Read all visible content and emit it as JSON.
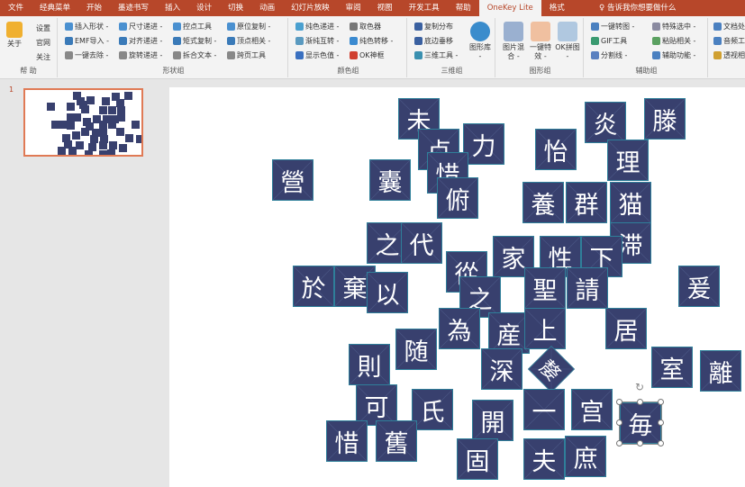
{
  "tabs": [
    "文件",
    "经典菜单",
    "开始",
    "墨迹书写",
    "插入",
    "设计",
    "切换",
    "动画",
    "幻灯片放映",
    "审阅",
    "视图",
    "开发工具",
    "帮助",
    "OneKey Lite",
    "格式"
  ],
  "tell_me": "告诉我你想要做什么",
  "groups": {
    "help": {
      "label": "帮 助",
      "about": "关于",
      "items": [
        "设置",
        "官网",
        "关注"
      ]
    },
    "shape": {
      "label": "形状组",
      "items": [
        "插入形状 -",
        "EMF导入 -",
        "一键去除 -",
        "尺寸递进 -",
        "对齐递进 -",
        "旋转递进 -",
        "控点工具",
        "矩式复制 -",
        "拆合文本 -",
        "原位复制 -",
        "顶点相关 -",
        "跨页工具"
      ]
    },
    "color": {
      "label": "颜色组",
      "items": [
        "纯色递进 -",
        "渐纯互转 -",
        "显示色值 -",
        "取色器",
        "纯色转移 -",
        "OK神框"
      ]
    },
    "3d": {
      "label": "三维组",
      "items": [
        "复制分布",
        "底边垂移",
        "三维工具 -"
      ],
      "big": "图形库 -"
    },
    "image": {
      "label": "图形组",
      "big": [
        "图片混合 -",
        "一键特效 -",
        "OK拼图 -"
      ]
    },
    "assist": {
      "label": "辅助组",
      "items": [
        "一键转图 -",
        "GIF工具",
        "分割线 -",
        "特殊选中 -",
        "粘贴相关 -",
        "辅助功能 -"
      ]
    },
    "extra": {
      "items": [
        "文档处",
        "音频工",
        "透视相"
      ]
    }
  },
  "slide_number": "1",
  "tiles": [
    "未",
    "炎",
    "滕",
    "力",
    "怡",
    "卢",
    "惜",
    "理",
    "營",
    "囊",
    "俯",
    "養",
    "群",
    "猫",
    "之",
    "代",
    "滞",
    "家",
    "性",
    "下",
    "從",
    "於",
    "棄",
    "以",
    "聖",
    "請",
    "爰",
    "之",
    "為",
    "産",
    "上",
    "居",
    "則",
    "随",
    "室",
    "離",
    "深",
    "嫠",
    "可",
    "氏",
    "一",
    "宫",
    "開",
    "惜",
    "舊",
    "固",
    "夫",
    "庶",
    "毎"
  ],
  "colors": {
    "accent": "#b7472a",
    "tile": "#38406e"
  }
}
